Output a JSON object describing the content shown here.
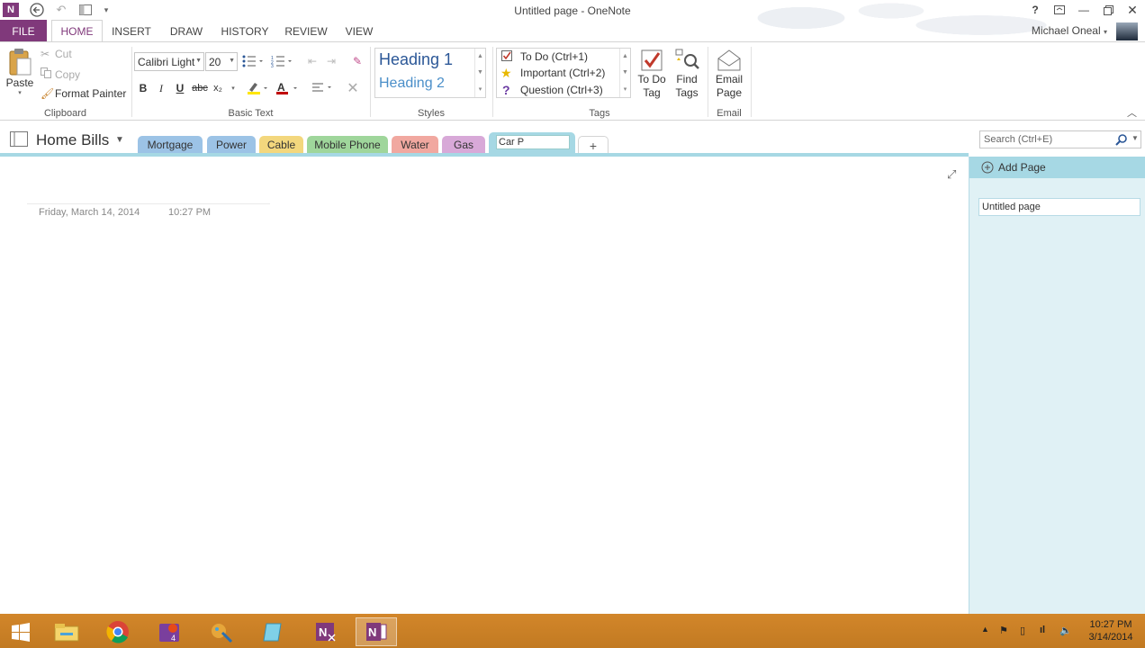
{
  "window": {
    "title": "Untitled page - OneNote",
    "user": "Michael Oneal"
  },
  "ribbon_tabs": [
    "FILE",
    "HOME",
    "INSERT",
    "DRAW",
    "HISTORY",
    "REVIEW",
    "VIEW"
  ],
  "clipboard": {
    "paste": "Paste",
    "cut": "Cut",
    "copy": "Copy",
    "format_painter": "Format Painter",
    "label": "Clipboard"
  },
  "basic_text": {
    "font": "Calibri Light",
    "size": "20",
    "bold": "B",
    "italic": "I",
    "underline": "U",
    "strike": "abc",
    "subscript": "x₂",
    "label": "Basic Text"
  },
  "styles": {
    "heading1": "Heading 1",
    "heading2": "Heading 2",
    "label": "Styles"
  },
  "tags": {
    "todo": "To Do (Ctrl+1)",
    "important": "Important (Ctrl+2)",
    "question": "Question (Ctrl+3)",
    "todo_tag_line1": "To Do",
    "todo_tag_line2": "Tag",
    "find_tags_line1": "Find",
    "find_tags_line2": "Tags",
    "label": "Tags"
  },
  "email": {
    "line1": "Email",
    "line2": "Page",
    "label": "Email"
  },
  "notebook": {
    "name": "Home Bills",
    "sections": [
      {
        "label": "Mortgage",
        "color": "#9cc3e6"
      },
      {
        "label": "Power",
        "color": "#9cc3e6"
      },
      {
        "label": "Cable",
        "color": "#f3d77d"
      },
      {
        "label": "Mobile Phone",
        "color": "#9fd69b"
      },
      {
        "label": "Water",
        "color": "#f1a8a0"
      },
      {
        "label": "Gas",
        "color": "#d8a9d8"
      }
    ],
    "editing_section": "Car P",
    "add_section": "+"
  },
  "search": {
    "placeholder": "Search (Ctrl+E)"
  },
  "page": {
    "date": "Friday, March 14, 2014",
    "time": "10:27 PM"
  },
  "page_list": {
    "add_page": "Add Page",
    "pages": [
      "Untitled page"
    ]
  },
  "taskbar": {
    "time": "10:27 PM",
    "date": "3/14/2014"
  }
}
